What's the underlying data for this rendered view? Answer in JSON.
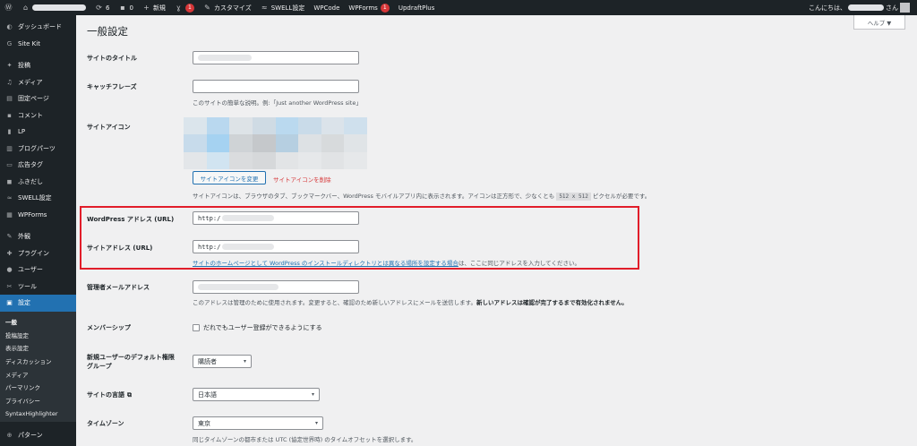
{
  "adminbar": {
    "wp_icon": "wordpress-logo-icon",
    "updates_count": "6",
    "comments_count": "0",
    "new_label": "新規",
    "yoast_badge": "1",
    "customize_label": "カスタマイズ",
    "swell_label": "SWELL設定",
    "wpcode_label": "WPCode",
    "wpforms_label": "WPForms",
    "wpforms_badge": "1",
    "updraft_label": "UpdraftPlus",
    "greeting_prefix": "こんにちは、",
    "greeting_suffix": "さん"
  },
  "sidebar": {
    "items": [
      {
        "label": "ダッシュボード",
        "icon": "dashboard-icon"
      },
      {
        "label": "Site Kit",
        "icon": "sitekit-icon"
      },
      {
        "label": "投稿",
        "icon": "pin-icon"
      },
      {
        "label": "メディア",
        "icon": "media-icon"
      },
      {
        "label": "固定ページ",
        "icon": "page-icon"
      },
      {
        "label": "コメント",
        "icon": "comment-icon"
      },
      {
        "label": "LP",
        "icon": "lp-icon"
      },
      {
        "label": "ブログパーツ",
        "icon": "blogparts-icon"
      },
      {
        "label": "広告タグ",
        "icon": "ad-icon"
      },
      {
        "label": "ふきだし",
        "icon": "balloon-icon"
      },
      {
        "label": "SWELL設定",
        "icon": "swell-icon"
      },
      {
        "label": "WPForms",
        "icon": "wpforms-icon"
      },
      {
        "label": "外観",
        "icon": "appearance-icon"
      },
      {
        "label": "プラグイン",
        "icon": "plugin-icon"
      },
      {
        "label": "ユーザー",
        "icon": "user-icon"
      },
      {
        "label": "ツール",
        "icon": "tool-icon"
      },
      {
        "label": "設定",
        "icon": "settings-icon"
      }
    ],
    "submenu": [
      "一般",
      "投稿設定",
      "表示設定",
      "ディスカッション",
      "メディア",
      "パーマリンク",
      "プライバシー",
      "SyntaxHighlighter"
    ],
    "bottom_item": "パターン"
  },
  "page": {
    "title": "一般設定",
    "help": "ヘルプ ▼"
  },
  "form": {
    "site_title_label": "サイトのタイトル",
    "tagline_label": "キャッチフレーズ",
    "tagline_desc": "このサイトの簡単な説明。例:「Just another WordPress site」",
    "site_icon_label": "サイトアイコン",
    "change_icon_button": "サイトアイコンを変更",
    "remove_icon_link": "サイトアイコンを削除",
    "site_icon_desc_1": "サイトアイコンは、ブラウザのタブ、ブックマークバー、WordPress モバイルアプリ内に表示されます。アイコンは正方形で、少なくとも ",
    "site_icon_code": "512 x 512",
    "site_icon_desc_2": " ピクセルが必要です。",
    "wp_address_label": "WordPress アドレス (URL)",
    "wp_address_value": "http:/",
    "site_address_label": "サイトアドレス (URL)",
    "site_address_value": "http:/",
    "site_address_link": "サイトのホームページとして WordPress のインストールディレクトリとは異なる場所を設定する場合",
    "site_address_desc": "は、ここに同じアドレスを入力してください。",
    "admin_email_label": "管理者メールアドレス",
    "admin_email_desc_1": "このアドレスは管理のために使用されます。変更すると、確認のため新しいアドレスにメールを送信します。",
    "admin_email_desc_2": "新しいアドレスは確認が完了するまで有効化されません。",
    "membership_label": "メンバーシップ",
    "membership_checkbox": "だれでもユーザー登録ができるようにする",
    "default_role_label_1": "新規ユーザーのデフォルト権限",
    "default_role_label_2": "グループ",
    "default_role_value": "購読者",
    "site_language_label": "サイトの言語",
    "site_language_value": "日本語",
    "timezone_label": "タイムゾーン",
    "timezone_value": "東京",
    "timezone_desc": "同じタイムゾーンの都市または UTC (協定世界時) のタイムオフセットを選択します。"
  },
  "colors": {
    "adminbar": "#1d2327",
    "active_menu": "#2271b1",
    "highlight": "#e11d2a",
    "link": "#2271b1",
    "danger": "#d63638"
  }
}
